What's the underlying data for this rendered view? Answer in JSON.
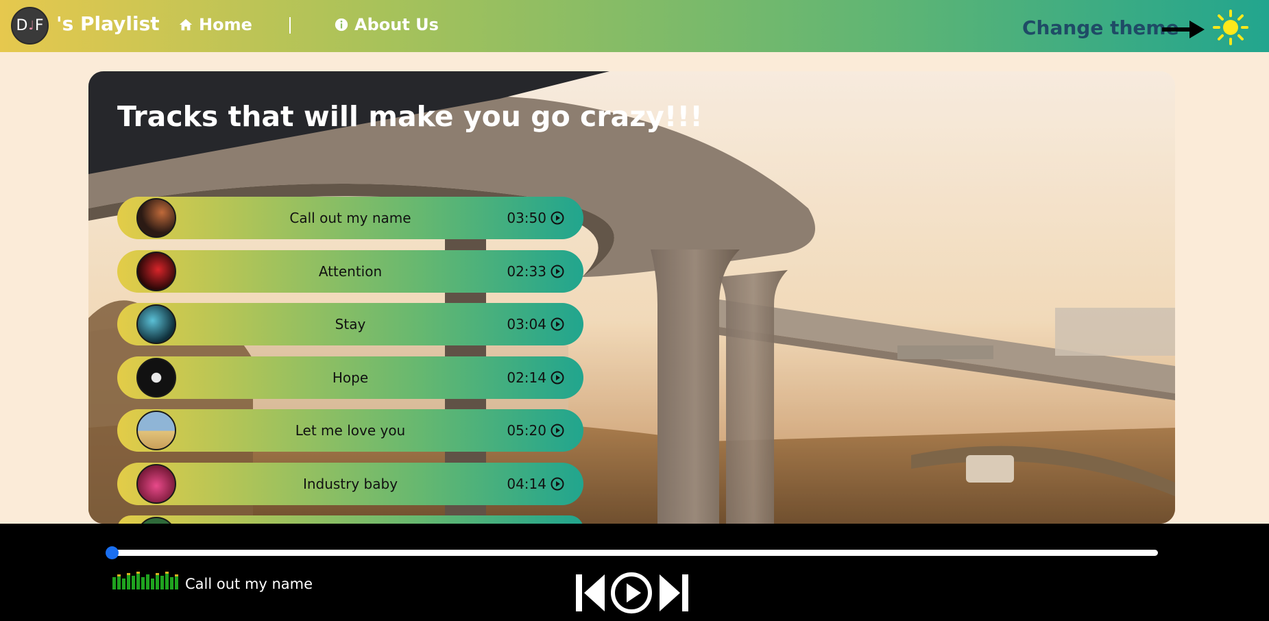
{
  "navbar": {
    "logo_left": "D",
    "logo_mid": "♩",
    "logo_right": "F",
    "brand_title": "'s Playlist",
    "links": [
      {
        "label": "Home",
        "icon": "home-icon"
      },
      {
        "label": "About Us",
        "icon": "info-icon"
      }
    ],
    "separator": "|",
    "change_theme_label": "Change theme",
    "theme_icon": "sun-icon",
    "colors": {
      "gradient_start": "#e6c84e",
      "gradient_end": "#22a58e",
      "theme_text": "#1f4b66",
      "sun": "#ffe81a"
    }
  },
  "hero": {
    "title": "Tracks that will make you go crazy!!!",
    "tracks": [
      {
        "name": "Call out my name",
        "duration": "03:50",
        "thumb_colors": [
          "#2b1a14",
          "#c06a3a"
        ]
      },
      {
        "name": "Attention",
        "duration": "02:33",
        "thumb_colors": [
          "#2a0707",
          "#d8252a"
        ]
      },
      {
        "name": "Stay",
        "duration": "03:04",
        "thumb_colors": [
          "#0f2f3a",
          "#5bc0d6"
        ]
      },
      {
        "name": "Hope",
        "duration": "02:14",
        "thumb_colors": [
          "#111111",
          "#e8e8e8"
        ]
      },
      {
        "name": "Let me love you",
        "duration": "05:20",
        "thumb_colors": [
          "#8fb5d6",
          "#e1c27a"
        ]
      },
      {
        "name": "Industry baby",
        "duration": "04:14",
        "thumb_colors": [
          "#7a1a3a",
          "#e84a8a"
        ]
      }
    ]
  },
  "player": {
    "now_playing": "Call out my name",
    "progress": 0,
    "controls": [
      "previous-icon",
      "play-icon",
      "next-icon"
    ],
    "accent": "#1a6ff0"
  }
}
